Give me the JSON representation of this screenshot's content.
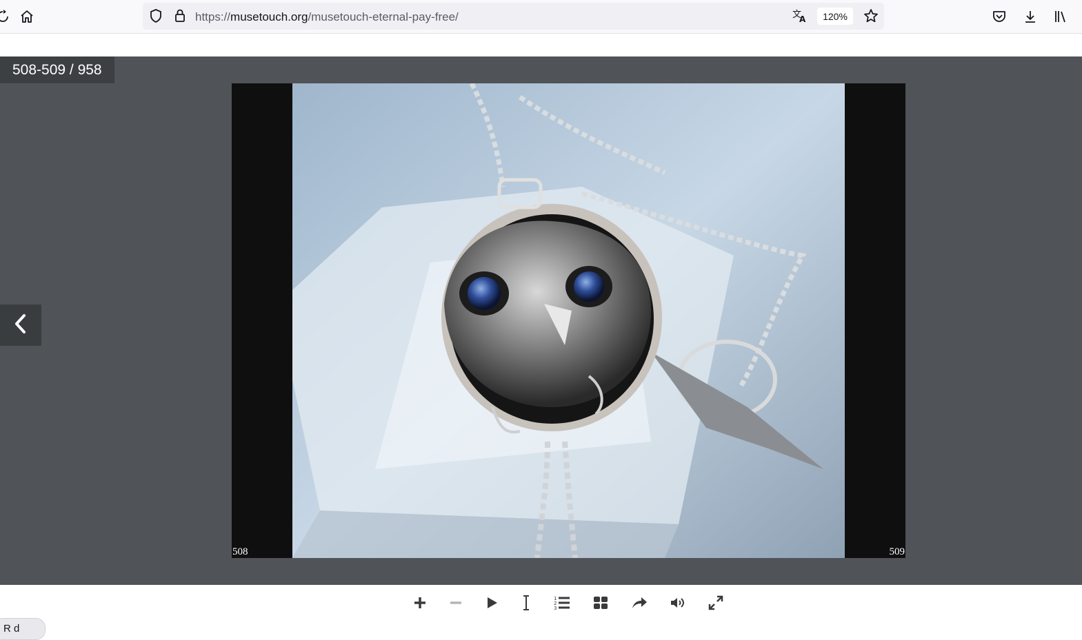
{
  "browser": {
    "url_prefix": "https://",
    "url_host": "musetouch.org",
    "url_path": "/musetouch-eternal-pay-free/",
    "zoom": "120%",
    "icons": [
      "reload-icon",
      "home-icon",
      "shield-icon",
      "lock-icon",
      "translate-icon",
      "star-icon",
      "pocket-icon",
      "download-icon",
      "library-icon"
    ]
  },
  "viewer": {
    "page_counter": "508-509 / 958",
    "left_page_number": "508",
    "right_page_number": "509",
    "background_color": "#505357"
  },
  "controls": {
    "icons": [
      "zoom-in-icon",
      "zoom-out-icon",
      "play-icon",
      "text-cursor-icon",
      "table-of-contents-icon",
      "thumbnails-icon",
      "share-icon",
      "sound-icon",
      "fullscreen-icon"
    ]
  },
  "bottom_pill": {
    "label": "R d"
  }
}
